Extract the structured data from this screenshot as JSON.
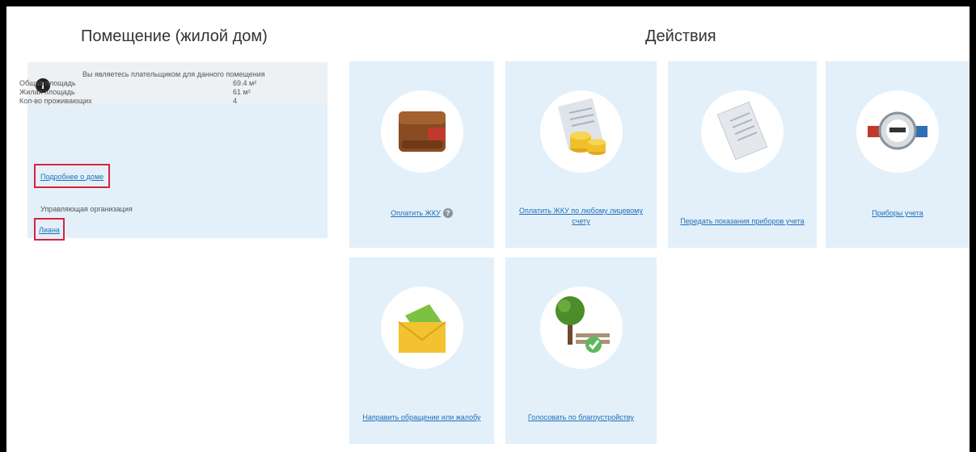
{
  "premises": {
    "title": "Помещение (жилой дом)",
    "notice": "Вы являетесь плательщиком для данного помещения",
    "stats": [
      {
        "label": "Общая площадь",
        "value": "69.4 м²"
      },
      {
        "label": "Жилая площадь",
        "value": "61 м²"
      },
      {
        "label": "Кол-во проживающих",
        "value": "4"
      }
    ],
    "house_link": "Подробнее о доме",
    "org_label": "Управляющая организация",
    "org_link": "Лиана"
  },
  "actions": {
    "title": "Действия",
    "tiles": [
      {
        "label": "Оплатить ЖКУ",
        "icon": "wallet-icon"
      },
      {
        "label": "Оплатить ЖКУ по любому лицевому счету",
        "icon": "coins-receipt-icon"
      },
      {
        "label": "Передать показания приборов учета",
        "icon": "receipt-icon"
      },
      {
        "label": "Приборы учета",
        "icon": "water-meter-icon"
      },
      {
        "label": "Направить обращение или жалобу",
        "icon": "envelope-icon"
      },
      {
        "label": "Голосовать по благоустройству",
        "icon": "tree-bench-icon"
      }
    ]
  },
  "colors": {
    "accent": "#1f6fb8",
    "tile_bg": "#e3f0fa",
    "highlight": "#d9233a"
  }
}
